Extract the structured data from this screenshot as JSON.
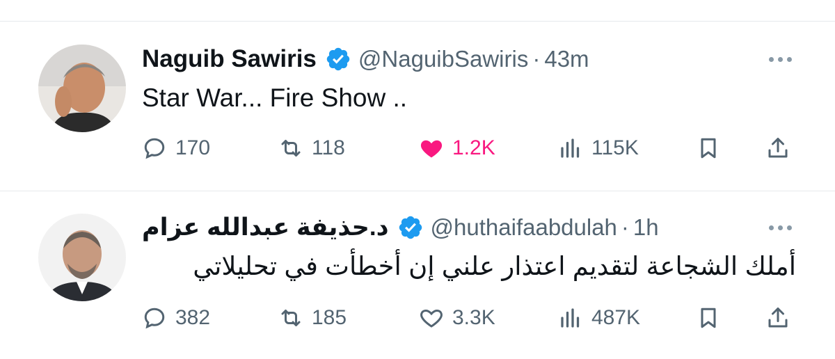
{
  "tweets": [
    {
      "name": "Naguib Sawiris",
      "handle": "@NaguibSawiris",
      "sep": "·",
      "time": "43m",
      "text": "Star War... Fire Show ..",
      "replies": "170",
      "retweets": "118",
      "likes": "1.2K",
      "liked": true,
      "views": "115K"
    },
    {
      "name": "د.حذيفة عبدالله عزام",
      "handle": "@huthaifaabdulah",
      "sep": "·",
      "time": "1h",
      "text": "أملك الشجاعة لتقديم اعتذار علني إن أخطأت في تحليلاتي",
      "replies": "382",
      "retweets": "185",
      "likes": "3.3K",
      "liked": false,
      "views": "487K"
    }
  ],
  "colors": {
    "verified": "#1d9bf0",
    "like_active": "#f91880",
    "muted": "#536471",
    "divider": "#e6e9ec"
  }
}
